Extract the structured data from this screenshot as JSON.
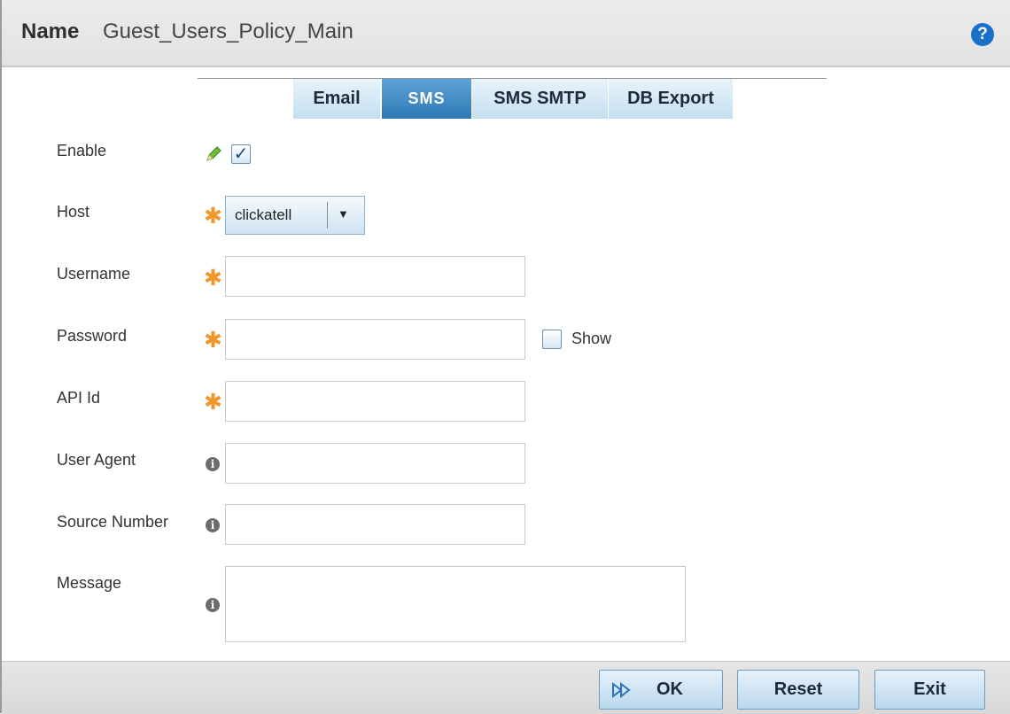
{
  "header": {
    "name_label": "Name",
    "name_value": "Guest_Users_Policy_Main",
    "help_icon": "question-icon"
  },
  "tabs": [
    {
      "label": "Email",
      "active": false
    },
    {
      "label": "SMS",
      "active": true
    },
    {
      "label": "SMS SMTP",
      "active": false
    },
    {
      "label": "DB Export",
      "active": false
    }
  ],
  "form": {
    "enable": {
      "label": "Enable",
      "checked": true,
      "icon": "pencil-icon"
    },
    "host": {
      "label": "Host",
      "value": "clickatell",
      "required": true
    },
    "username": {
      "label": "Username",
      "value": "",
      "required": true
    },
    "password": {
      "label": "Password",
      "value": "",
      "required": true,
      "show_label": "Show",
      "show_checked": false
    },
    "api_id": {
      "label": "API Id",
      "value": "",
      "required": true
    },
    "user_agent": {
      "label": "User Agent",
      "value": "",
      "info_icon": "info-icon"
    },
    "source_number": {
      "label": "Source Number",
      "value": "",
      "info_icon": "info-icon"
    },
    "message": {
      "label": "Message",
      "value": "",
      "info_icon": "info-icon"
    }
  },
  "footer": {
    "ok_label": "OK",
    "reset_label": "Reset",
    "exit_label": "Exit"
  },
  "colors": {
    "accent": "#2d79b5",
    "required_star": "#f0962b",
    "help": "#1a71c9"
  }
}
